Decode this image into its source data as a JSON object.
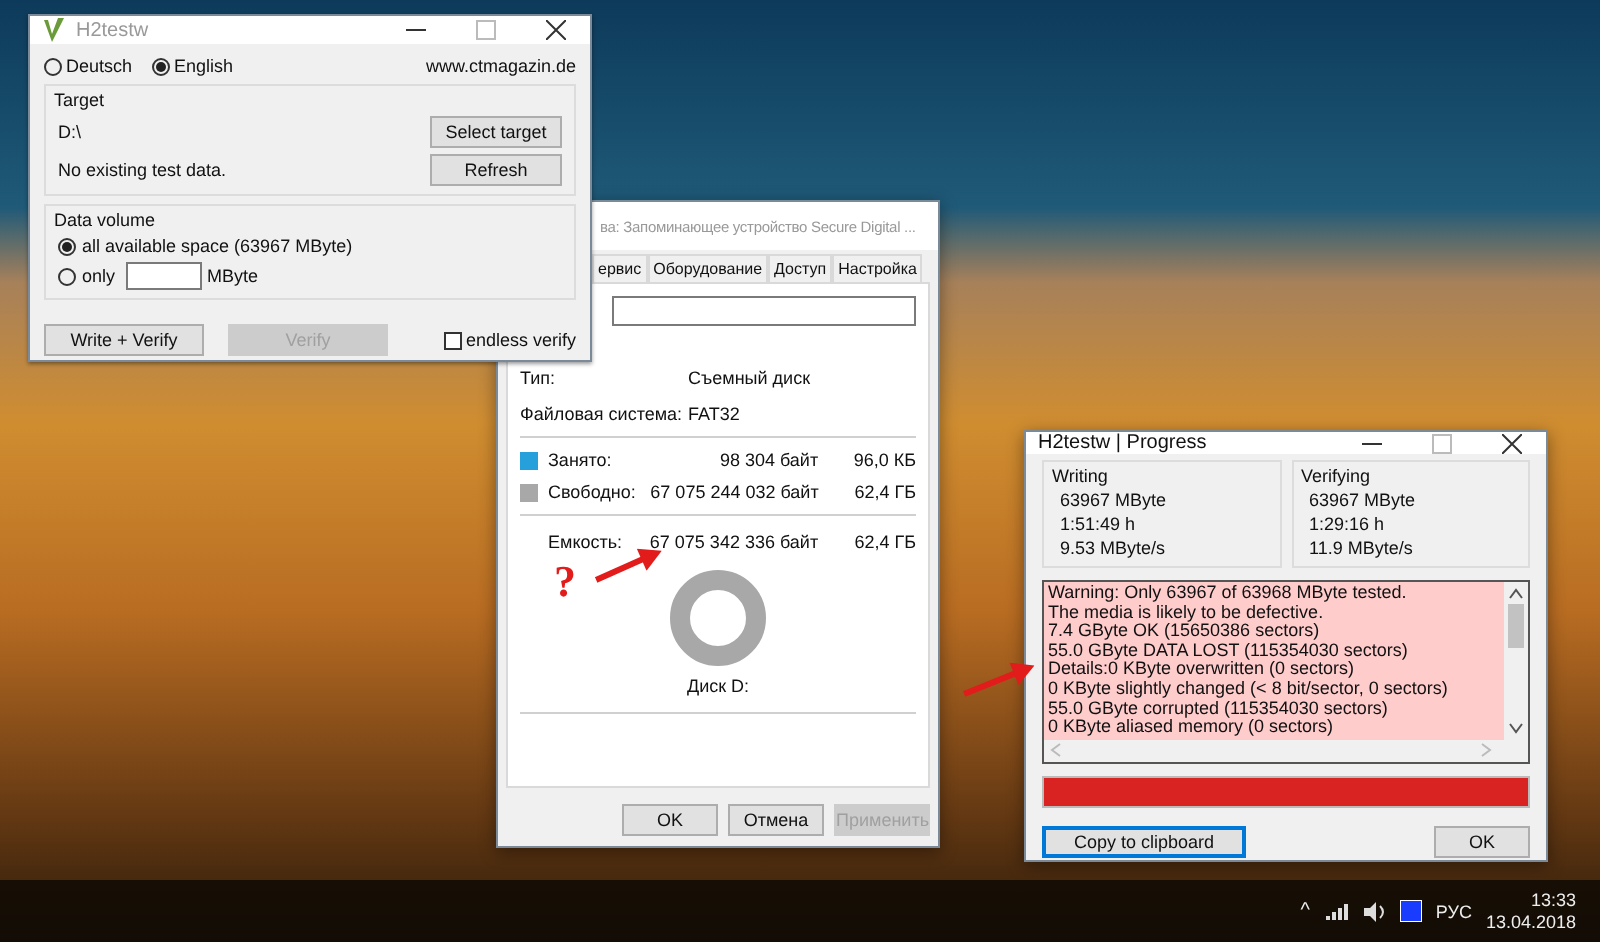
{
  "h2testw": {
    "title": "H2testw",
    "languages": [
      {
        "label": "Deutsch",
        "selected": false
      },
      {
        "label": "English",
        "selected": true
      }
    ],
    "website": "www.ctmagazin.de",
    "target": {
      "label": "Target",
      "path": "D:\\",
      "status": "No existing test data.",
      "buttons": [
        "Select target",
        "Refresh"
      ]
    },
    "data_volume": {
      "label": "Data volume",
      "options": [
        {
          "kind": "plain",
          "label": "all available space (63967 MByte)",
          "selected": true
        },
        {
          "kind": "amount",
          "label": "only",
          "unit": "MByte",
          "selected": false
        }
      ]
    },
    "buttons": [
      {
        "label": "Write + Verify",
        "disabled": false
      },
      {
        "label": "Verify",
        "disabled": true
      }
    ],
    "endless_verify": {
      "label": "endless verify",
      "checked": false
    }
  },
  "properties": {
    "title": "ва: Запоминающее устройство Secure Digital ...",
    "tabs": [
      {
        "label": "ервис",
        "selected": false
      },
      {
        "label": "Оборудование",
        "selected": false
      },
      {
        "label": "Доступ",
        "selected": false
      },
      {
        "label": "Настройка",
        "selected": false
      }
    ],
    "info": [
      {
        "label": "Тип:",
        "value": "Съемный диск"
      },
      {
        "label": "Файловая система:",
        "value": "FAT32"
      }
    ],
    "space": [
      {
        "label": "Занято:",
        "bytes": "98 304 байт",
        "size": "96,0 КБ",
        "color": "#26a0da"
      },
      {
        "label": "Свободно:",
        "bytes": "67 075 244 032 байт",
        "size": "62,4 ГБ",
        "color": "#a8a8a8"
      }
    ],
    "capacity": {
      "label": "Емкость:",
      "bytes": "67 075 342 336 байт",
      "size": "62,4 ГБ"
    },
    "disk_label": "Диск D:",
    "buttons": [
      {
        "label": "OK",
        "disabled": false
      },
      {
        "label": "Отмена",
        "disabled": false
      },
      {
        "label": "Применить",
        "disabled": true
      }
    ]
  },
  "progress": {
    "title": "H2testw | Progress",
    "panels": [
      {
        "label": "Writing",
        "lines": [
          "63967 MByte",
          "1:51:49 h",
          "9.53 MByte/s"
        ]
      },
      {
        "label": "Verifying",
        "lines": [
          "63967 MByte",
          "1:29:16 h",
          "11.9 MByte/s"
        ]
      }
    ],
    "log": [
      "Warning: Only 63967 of 63968 MByte tested.",
      "The media is likely to be defective.",
      "7.4 GByte OK (15650386 sectors)",
      "55.0 GByte DATA LOST (115354030 sectors)",
      "Details:0 KByte overwritten (0 sectors)",
      "0 KByte slightly changed (< 8 bit/sector, 0 sectors)",
      "55.0 GByte corrupted (115354030 sectors)",
      "0 KByte aliased memory (0 sectors)"
    ],
    "bar": {
      "level": 1
    },
    "buttons": [
      {
        "label": "Copy to clipboard",
        "focused": true
      },
      {
        "label": "OK",
        "focused": false
      }
    ]
  },
  "annotation": {
    "mark": "?"
  },
  "taskbar": {
    "up": "^",
    "language": "РУС",
    "time": "13:33",
    "date": "13.04.2018"
  }
}
